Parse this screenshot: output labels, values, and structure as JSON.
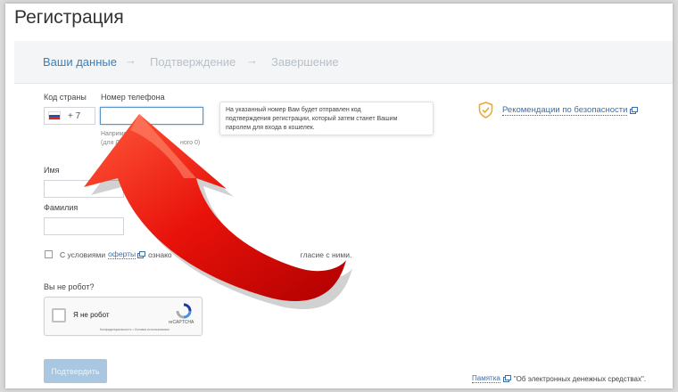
{
  "page": {
    "title": "Регистрация"
  },
  "steps": [
    {
      "label": "Ваши данные"
    },
    {
      "label": "Подтверждение"
    },
    {
      "label": "Завершение"
    }
  ],
  "step_arrow": "→",
  "form": {
    "country_label": "Код страны",
    "country_code": "+ 7",
    "phone_label": "Номер телефона",
    "phone_hint_line1": "Например 9",
    "phone_hint_line1_tail": "ного 0)",
    "phone_hint_line2": "(для Литвы",
    "first_name_label": "Имя",
    "last_name_label": "Фамилия",
    "terms_prefix": "С условиями",
    "terms_link": "оферты",
    "terms_middle": "ознако",
    "terms_suffix": "гласие с ними.",
    "robot_label": "Вы не робот?"
  },
  "tooltip": {
    "text_line1": "На указанный номер Вам будет отправлен код",
    "text_line2": "подтверждения регистрации, который затем станет Вашим",
    "text_line3": "паролем для входа в кошелек."
  },
  "security": {
    "link": "Рекомендации по безопасности"
  },
  "captcha": {
    "label": "Я не робот",
    "brand": "reCAPTCHA",
    "terms": "Конфиденциальность • Условия использования"
  },
  "submit": {
    "label": "Подтвердить"
  },
  "memo": {
    "link": "Памятка",
    "text": "\"Об электронных денежных средствах\"."
  },
  "colors": {
    "accent": "#3d7fb6",
    "arrow": "#e8120a",
    "button": "#a9c7e0",
    "shield": "#f0a830"
  }
}
